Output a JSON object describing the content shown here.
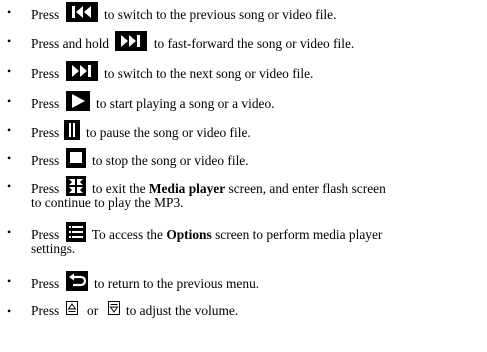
{
  "items": [
    {
      "pre": "Press",
      "icon": "previous-track-icon",
      "post": "to switch to the previous song or video file."
    },
    {
      "pre": "Press and hold",
      "icon": "fast-forward-icon",
      "post": "to fast-forward the song or video file."
    },
    {
      "pre": "Press",
      "icon": "next-track-icon",
      "post": "to switch to the next song or video file."
    },
    {
      "pre": "Press",
      "icon": "play-icon",
      "post": "to start playing a song or a video."
    },
    {
      "pre": "Press",
      "icon": "pause-icon",
      "post": "to pause the song or video file."
    },
    {
      "pre": "Press",
      "icon": "stop-icon",
      "post": "to stop the song or video file."
    },
    {
      "pre": "Press",
      "icon": "exit-fullscreen-icon",
      "post_a": "to exit the",
      "bold": "Media player",
      "post_b": "screen, and enter flash screen",
      "line2": "to continue to play the MP3."
    },
    {
      "pre": "Press",
      "icon": "options-list-icon",
      "post_a": "To access the",
      "bold": "Options",
      "post_b": "screen to perform media player",
      "line2": "settings."
    },
    {
      "pre": "Press",
      "icon": "back-return-icon",
      "post": "to return to the previous menu."
    },
    {
      "pre": "Press",
      "icon": "volume-up-icon",
      "mid": "or",
      "icon2": "volume-down-icon",
      "post": "to adjust the volume."
    }
  ],
  "bullet_char": "•",
  "icon_color": "#000000"
}
